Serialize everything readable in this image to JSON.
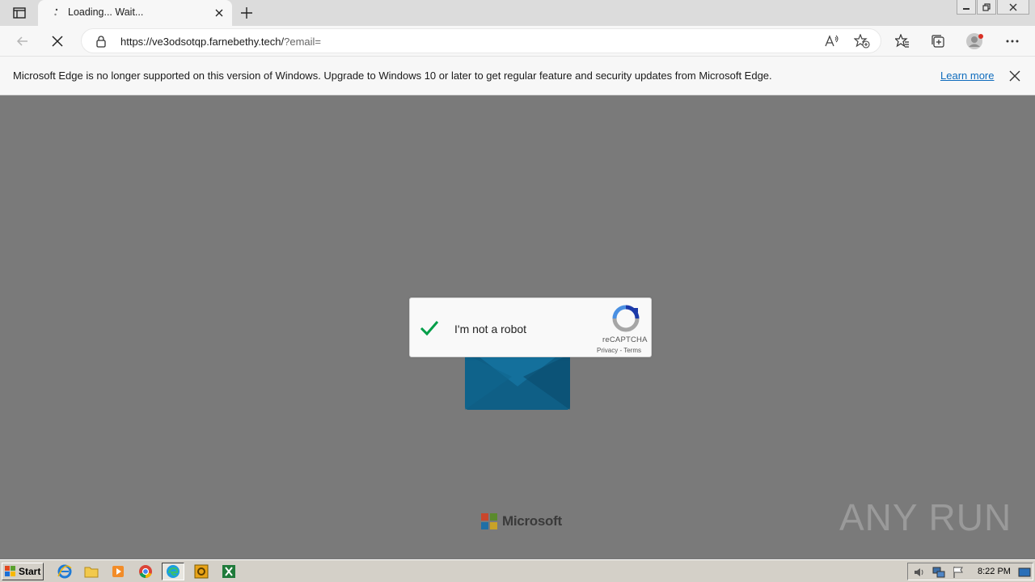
{
  "browser": {
    "tab": {
      "title": "Loading... Wait..."
    },
    "address": {
      "host": "https://ve3odsotqp.farnebethy.tech/",
      "rest": "?email="
    }
  },
  "infobar": {
    "message": "Microsoft Edge is no longer supported on this version of Windows. Upgrade to Windows 10 or later to get regular feature and security updates from Microsoft Edge.",
    "learn_more": "Learn more"
  },
  "captcha": {
    "label": "I'm not a robot",
    "brand": "reCAPTCHA",
    "privacy": "Privacy",
    "separator": " - ",
    "terms": "Terms",
    "checked": true
  },
  "footer": {
    "logo_text": "Microsoft"
  },
  "watermark": {
    "text": "ANY RUN"
  },
  "taskbar": {
    "start_label": "Start",
    "clock": "8:22 PM",
    "apps": [
      "internet-explorer-icon",
      "file-explorer-icon",
      "media-player-icon",
      "chrome-icon",
      "edge-icon",
      "outlook-icon",
      "excel-icon"
    ]
  },
  "colors": {
    "page_bg": "#7a7a7a",
    "envelope": "#0f5f86",
    "check_green": "#009e48",
    "link": "#0f6cbd"
  }
}
